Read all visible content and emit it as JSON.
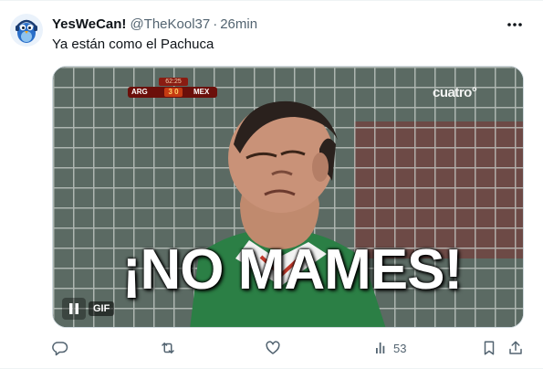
{
  "tweet": {
    "display_name": "YesWeCan!",
    "handle": "@TheKool37",
    "separator": "·",
    "time": "26min",
    "text": "Ya están como el Pachuca"
  },
  "media": {
    "type": "gif",
    "caption": "¡NO MAMES!",
    "channel_logo": "cuatro°",
    "scoreboard": {
      "clock": "62:25",
      "home": "ARG",
      "score": "3 0",
      "away": "MEX"
    },
    "gif_badge": "GIF",
    "pause_icon": "pause-icon"
  },
  "actions": {
    "reply_icon": "reply-icon",
    "retweet_icon": "retweet-icon",
    "like_icon": "heart-icon",
    "views_icon": "analytics-icon",
    "views_count": "53",
    "bookmark_icon": "bookmark-icon",
    "share_icon": "share-icon"
  },
  "colors": {
    "text_primary": "#0f1419",
    "text_secondary": "#536471",
    "border": "#cfd9de"
  }
}
